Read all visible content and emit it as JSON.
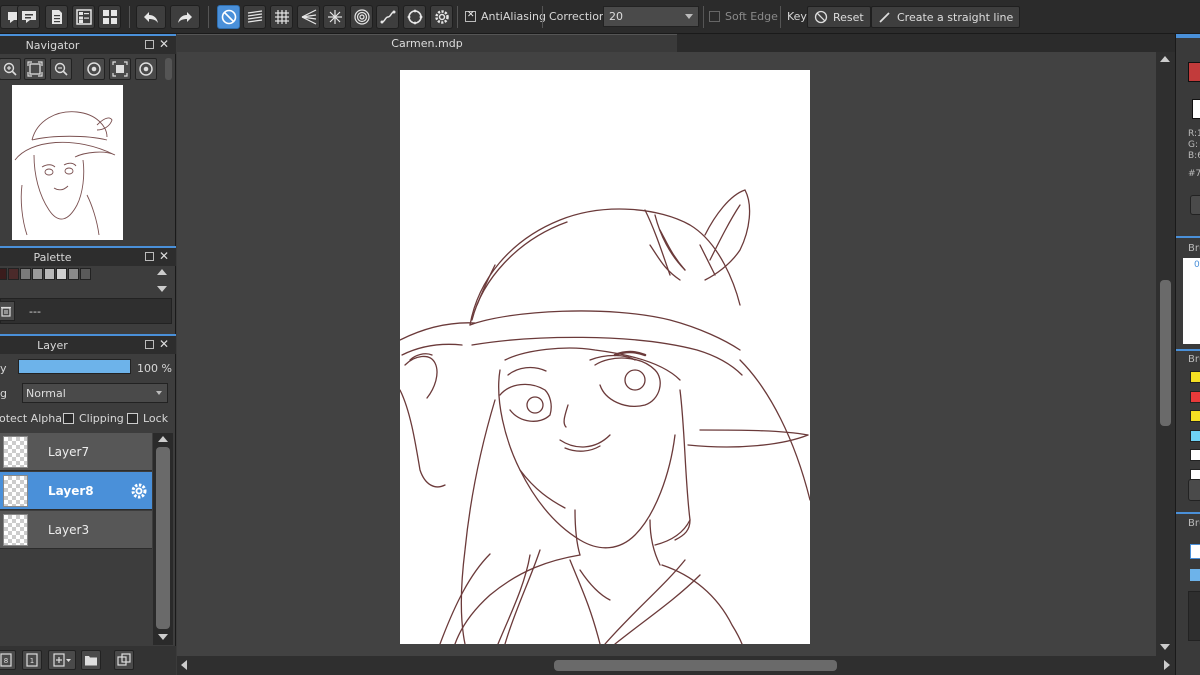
{
  "toolbar": {
    "antialiasing_label": "AntiAliasing",
    "correction_label": "Correction",
    "correction_value": "20",
    "soft_edge_label": "Soft Edge",
    "key_label": "Key",
    "reset_label": "Reset",
    "straight_line_label": "Create a straight line"
  },
  "document": {
    "tab_title": "Carmen.mdp"
  },
  "navigator": {
    "title": "Navigator"
  },
  "palette": {
    "title": "Palette",
    "field_value": "---",
    "swatches": [
      "#3a1c1c",
      "#4b2a2a",
      "#7a7a7a",
      "#9a9a9a",
      "#b8b8b8",
      "#d0d0d0",
      "#8a8a8a",
      "#5a5a5a"
    ]
  },
  "layer": {
    "title": "Layer",
    "opacity_label": "y",
    "opacity_value": "100 %",
    "opacity_fraction": 1.0,
    "blending_label": "g",
    "blending_value": "Normal",
    "protect_alpha_label": "otect Alpha",
    "clipping_label": "Clipping",
    "lock_label": "Lock",
    "items": [
      {
        "name": "Layer7",
        "selected": false
      },
      {
        "name": "Layer8",
        "selected": true
      },
      {
        "name": "Layer3",
        "selected": false
      }
    ]
  },
  "right_panel": {
    "r_label": "R:1",
    "g_label": "G:",
    "b_label": "B:6",
    "hex_label": "#7",
    "brush_label_1": "Bru",
    "brush_label_2": "Bru",
    "brush_label_3": "Bru",
    "brush_size_value": "0",
    "primary_color": "#c23b3b",
    "brush_colors": [
      "#f5e023",
      "#e83a3a",
      "#f5e023",
      "#6fd3f5",
      "#ffffff",
      "#ffffff"
    ]
  },
  "colors": {
    "accent": "#4a90d9",
    "line_art": "#6b3a3a"
  }
}
